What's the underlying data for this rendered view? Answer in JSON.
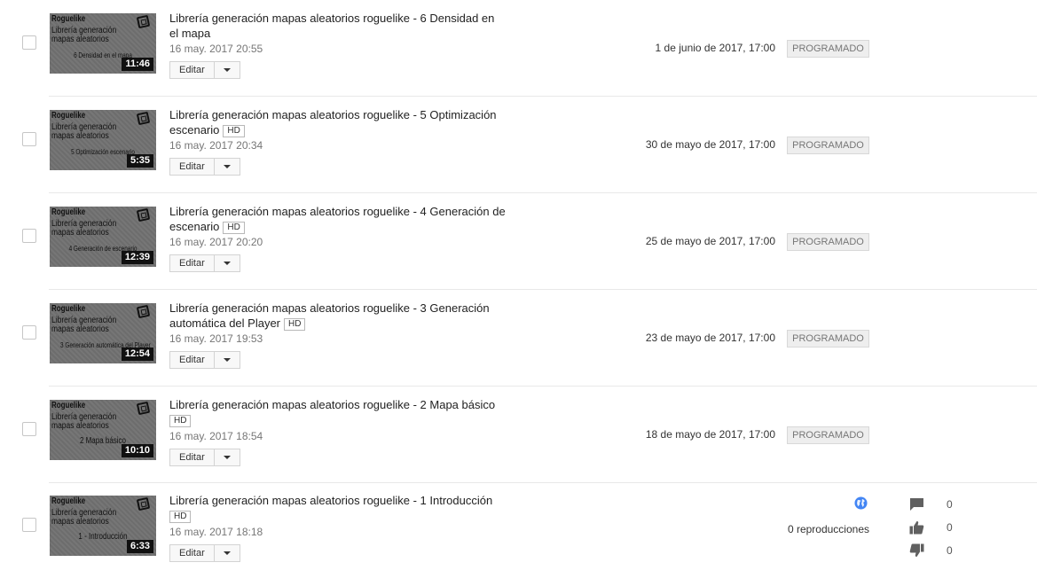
{
  "videos": [
    {
      "thumb": {
        "tag": "Roguelike",
        "line1": "Librería generación",
        "line2": "mapas aleatorios",
        "sub": "6 Densidad en el mapa"
      },
      "duration": "11:46",
      "title": "Librería generación mapas aleatorios roguelike - 6 Densidad en el mapa",
      "hd": "",
      "date": "16 may. 2017 20:55",
      "edit_label": "Editar",
      "scheduled": "1 de junio de 2017, 17:00",
      "status": "PROGRAMADO"
    },
    {
      "thumb": {
        "tag": "Roguelike",
        "line1": "Librería generación",
        "line2": "mapas aleatorios",
        "sub": "5 Optimización escenario"
      },
      "duration": "5:35",
      "title": "Librería generación mapas aleatorios roguelike - 5 Optimización escenario",
      "hd": "HD",
      "date": "16 may. 2017 20:34",
      "edit_label": "Editar",
      "scheduled": "30 de mayo de 2017, 17:00",
      "status": "PROGRAMADO"
    },
    {
      "thumb": {
        "tag": "Roguelike",
        "line1": "Librería generación",
        "line2": "mapas aleatorios",
        "sub": "4 Generación de escenario"
      },
      "duration": "12:39",
      "title": "Librería generación mapas aleatorios roguelike - 4 Generación de escenario",
      "hd": "HD",
      "date": "16 may. 2017 20:20",
      "edit_label": "Editar",
      "scheduled": "25 de mayo de 2017, 17:00",
      "status": "PROGRAMADO"
    },
    {
      "thumb": {
        "tag": "Roguelike",
        "line1": "Librería generación",
        "line2": "mapas aleatorios",
        "sub": "3 Generación automática del Player"
      },
      "duration": "12:54",
      "title": "Librería generación mapas aleatorios roguelike - 3 Generación automática del Player",
      "hd": "HD",
      "date": "16 may. 2017 19:53",
      "edit_label": "Editar",
      "scheduled": "23 de mayo de 2017, 17:00",
      "status": "PROGRAMADO"
    },
    {
      "thumb": {
        "tag": "Roguelike",
        "line1": "Librería generación",
        "line2": "mapas aleatorios",
        "sub": "2 Mapa básico"
      },
      "duration": "10:10",
      "title": "Librería generación mapas aleatorios roguelike - 2 Mapa básico",
      "hd": "HD",
      "date": "16 may. 2017 18:54",
      "edit_label": "Editar",
      "scheduled": "18 de mayo de 2017, 17:00",
      "status": "PROGRAMADO"
    },
    {
      "thumb": {
        "tag": "Roguelike",
        "line1": "Librería generación",
        "line2": "mapas aleatorios",
        "sub": "1 - Introducción"
      },
      "duration": "6:33",
      "title": "Librería generación mapas aleatorios roguelike - 1 Introducción",
      "hd": "HD",
      "date": "16 may. 2017 18:18",
      "edit_label": "Editar",
      "visibility_icon": "globe-icon",
      "views": "0 reproducciones",
      "comments": "0",
      "likes": "0",
      "dislikes": "0"
    }
  ],
  "colors": {
    "badge_bg": "#eeeeee",
    "badge_text": "#767676",
    "globe": "#4285f4",
    "icon_gray": "#606060"
  }
}
